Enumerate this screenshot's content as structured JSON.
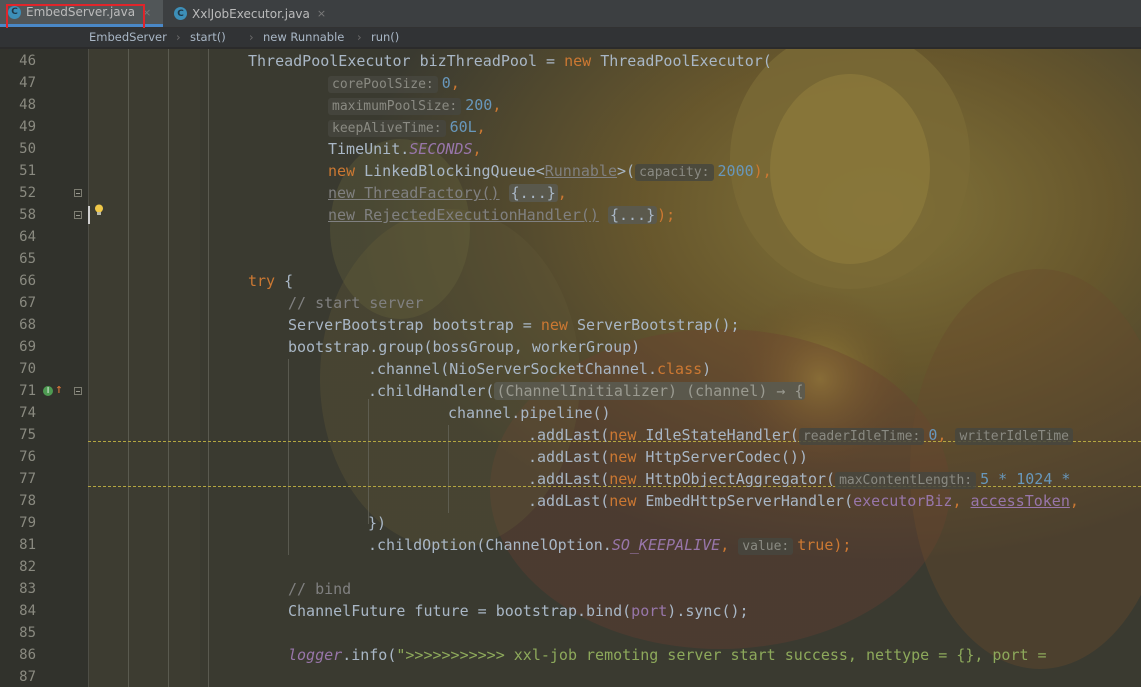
{
  "tabs": [
    {
      "label": "EmbedServer.java",
      "icon": "c-class-icon",
      "active": true
    },
    {
      "label": "XxlJobExecutor.java",
      "icon": "c-class-icon",
      "active": false
    }
  ],
  "breadcrumb": [
    "EmbedServer",
    "start()",
    "new Runnable",
    "run()"
  ],
  "line_numbers": [
    "46",
    "47",
    "48",
    "49",
    "50",
    "51",
    "52",
    "58",
    "64",
    "65",
    "66",
    "67",
    "68",
    "69",
    "70",
    "71",
    "74",
    "75",
    "76",
    "77",
    "78",
    "79",
    "81",
    "82",
    "83",
    "84",
    "85",
    "86",
    "87"
  ],
  "code": {
    "l46_a": "ThreadPoolExecutor bizThreadPool = ",
    "l46_kw": "new",
    "l46_b": " ThreadPoolExecutor(",
    "l47_hint": "corePoolSize:",
    "l47_val": "0",
    "l47_end": ",",
    "l48_hint": "maximumPoolSize:",
    "l48_val": "200",
    "l48_end": ",",
    "l49_hint": "keepAliveTime:",
    "l49_val": "60L",
    "l49_end": ",",
    "l50_a": "TimeUnit.",
    "l50_it": "SECONDS",
    "l50_end": ",",
    "l51_kw": "new",
    "l51_a": " LinkedBlockingQueue<",
    "l51_b": "Runnable",
    "l51_c": ">(",
    "l51_hint": "capacity:",
    "l51_val": "2000",
    "l51_end": "),",
    "l52_a": "new ThreadFactory()",
    "l52_fold": "{...}",
    "l52_end": ",",
    "l58_a": "new RejectedExecutionHandler()",
    "l58_fold": "{...}",
    "l58_end": ");",
    "l66_kw": "try",
    "l66_end": " {",
    "l67_cm": "// start server",
    "l68_a": "ServerBootstrap bootstrap = ",
    "l68_kw": "new",
    "l68_b": " ServerBootstrap();",
    "l69_a": "bootstrap.group(bossGroup, workerGroup)",
    "l70_a": ".channel(NioServerSocketChannel.",
    "l70_kw": "class",
    "l70_end": ")",
    "l71_a": ".childHandler(",
    "l71_b": "(ChannelInitializer) (channel) → {",
    "l74_a": "channel.pipeline()",
    "l75_a": ".addLast(",
    "l75_kw": "new",
    "l75_b": " IdleStateHandler(",
    "l75_hint1": "readerIdleTime:",
    "l75_val": "0",
    "l75_c": ",",
    "l75_hint2": "writerIdleTime",
    "l76_a": ".addLast(",
    "l76_kw": "new",
    "l76_b": " HttpServerCodec())",
    "l77_a": ".addLast(",
    "l77_kw": "new",
    "l77_b": " HttpObjectAggregator(",
    "l77_hint": "maxContentLength:",
    "l77_val": "5 * 1024 *",
    "l78_a": ".addLast(",
    "l78_kw": "new",
    "l78_b": " EmbedHttpServerHandler(",
    "l78_f1": "executorBiz",
    "l78_c": ", ",
    "l78_f2": "accessToken",
    "l78_d": ",",
    "l79_a": "})",
    "l81_a": ".childOption(ChannelOption.",
    "l81_it": "SO_KEEPALIVE",
    "l81_b": ",",
    "l81_hint": "value:",
    "l81_kw": "true",
    "l81_end": ");",
    "l83_cm": "// bind",
    "l84_a": "ChannelFuture future = bootstrap.bind(",
    "l84_f": "port",
    "l84_b": ").sync();",
    "l86_it": "logger",
    "l86_a": ".info(",
    "l86_st": "\">>>>>>>>>>> xxl-job remoting server start success, nettype = {}, port = "
  },
  "colors": {
    "keyword": "#cc7832",
    "number": "#6897bb",
    "comment": "#808080",
    "string": "#8da95b",
    "field": "#9876aa",
    "default": "#a9b7c6",
    "tab_highlight": "#e0252b"
  }
}
